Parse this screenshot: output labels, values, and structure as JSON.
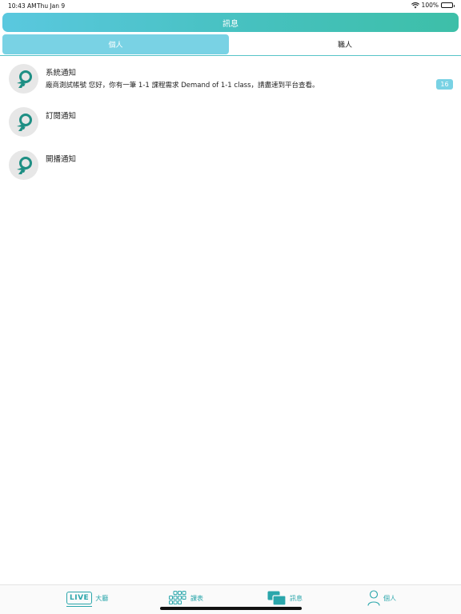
{
  "status_bar": {
    "time": "10:43 AM",
    "date": "Thu Jan 9",
    "battery": "100%"
  },
  "header": {
    "title": "訊息"
  },
  "tabs": [
    {
      "label": "個人",
      "selected": true
    },
    {
      "label": "職人",
      "selected": false
    }
  ],
  "messages": [
    {
      "title": "系統通知",
      "preview": "廠商測試帳號 您好，你有一筆 1-1 課程需求 Demand of 1-1 class，請盡速到平台查看。",
      "badge": "16"
    },
    {
      "title": "訂閱通知",
      "preview": "",
      "badge": ""
    },
    {
      "title": "開播通知",
      "preview": "",
      "badge": ""
    }
  ],
  "bottom_nav": {
    "live_icon_text": "LIVE",
    "items": [
      {
        "label": "大廳",
        "icon": "live-icon"
      },
      {
        "label": "課表",
        "icon": "grid-icon"
      },
      {
        "label": "訊息",
        "icon": "chat-icon",
        "active": true
      },
      {
        "label": "個人",
        "icon": "person-icon"
      }
    ]
  },
  "colors": {
    "accent": "#79d2e4",
    "gradient_start": "#5ac8df",
    "gradient_end": "#3dbfa8",
    "nav_teal": "#2aa6ab",
    "logo_green": "#1e8f84"
  }
}
